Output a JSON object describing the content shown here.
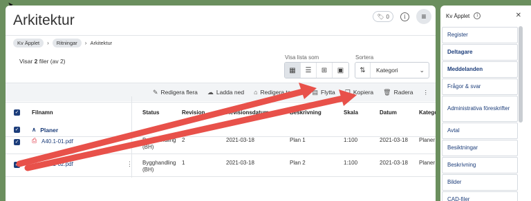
{
  "header": {
    "title": "Arkitektur",
    "notification_count": "0"
  },
  "breadcrumb": [
    "Kv Äpplet",
    "Ritningar",
    "Arkitektur"
  ],
  "listing": {
    "showing_prefix": "Visar",
    "showing_count": "2",
    "showing_suffix": "filer",
    "showing_total": "(av 2)"
  },
  "view": {
    "label": "Visa lista som",
    "options": [
      "table-icon",
      "list-icon",
      "grid-icon",
      "image-icon"
    ],
    "active": "table-icon"
  },
  "sort": {
    "label": "Sortera",
    "value": "Kategori"
  },
  "toolbar": {
    "edit_many": "Redigera flera",
    "download": "Ladda ned",
    "edit_tags": "Redigera taggar",
    "move": "Flytta",
    "copy": "Kopiera",
    "delete": "Radera"
  },
  "table": {
    "columns": [
      "Filnamn",
      "Status",
      "Revision",
      "Revisionsdatum",
      "Beskrivning",
      "Skala",
      "Datum",
      "Kategori"
    ],
    "group": "Planer",
    "rows": [
      {
        "file": "A40.1-01.pdf",
        "status": "Bygghandling (BH)",
        "revision": "2",
        "rev_date": "2021-03-18",
        "description": "Plan 1",
        "scale": "1:100",
        "date": "2021-03-18",
        "category": "Planer"
      },
      {
        "file": "A40.1-02.pdf",
        "status": "Bygghandling (BH)",
        "revision": "1",
        "rev_date": "2021-03-18",
        "description": "Plan 2",
        "scale": "1:100",
        "date": "2021-03-18",
        "category": "Planer"
      }
    ]
  },
  "sidebar": {
    "title": "Kv Äpplet",
    "items": [
      {
        "label": "Register",
        "bold": false
      },
      {
        "label": "Deltagare",
        "bold": true
      },
      {
        "label": "Meddelanden",
        "bold": true
      },
      {
        "label": "Frågor & svar",
        "bold": false
      },
      {
        "label": "Administrativa föreskrifter",
        "bold": false
      },
      {
        "label": "Avtal",
        "bold": false
      },
      {
        "label": "Besiktningar",
        "bold": false
      },
      {
        "label": "Beskrivning",
        "bold": false
      },
      {
        "label": "Bilder",
        "bold": false
      },
      {
        "label": "CAD-filer",
        "bold": false
      }
    ]
  },
  "colors": {
    "background": "#6b8f5e",
    "accent": "#1c3d7a",
    "arrow": "#e8514a"
  }
}
